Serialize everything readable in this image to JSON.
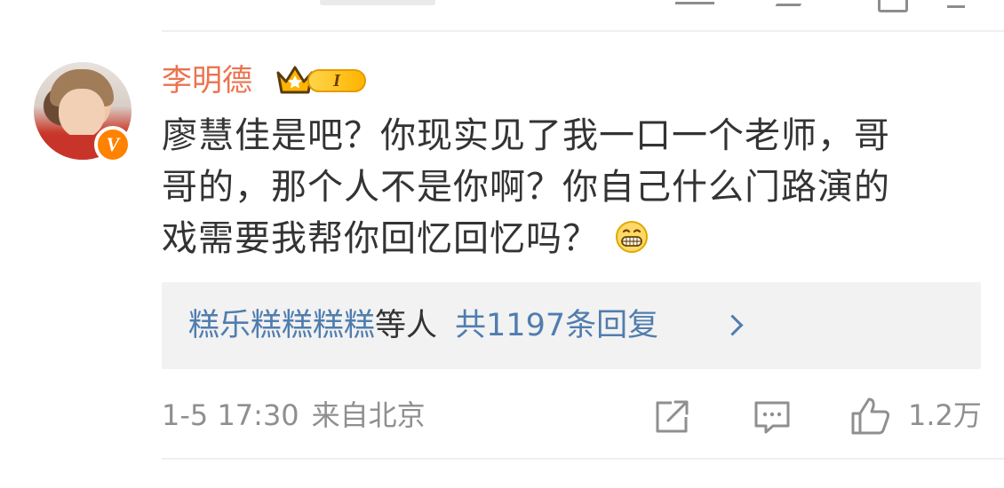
{
  "comment": {
    "username": "李明德",
    "vip_level": "I",
    "body_lines": [
      "廖慧佳是吧？你现实见了我一口一个老师，哥",
      "哥的，那个人不是你啊？你自己什么门路演的",
      "戏需要我帮你回忆回忆吗？"
    ],
    "emoji": "grin-emoji",
    "replies": {
      "names": "糕乐糕糕糕糕",
      "etc": "等人",
      "total": "共1197条回复"
    },
    "timestamp": "1-5 17:30",
    "location": "来自北京",
    "like_count": "1.2万"
  },
  "icons": {
    "verified": "verified-v-icon",
    "vip": "vip-crown-icon",
    "share": "share-icon",
    "reply": "comment-icon",
    "like": "thumbs-up-icon",
    "chevron": "chevron-right-icon"
  },
  "colors": {
    "username": "#eb7350",
    "link": "#507daf",
    "meta": "#8f8f8f",
    "verify_badge": "#ff8200"
  }
}
